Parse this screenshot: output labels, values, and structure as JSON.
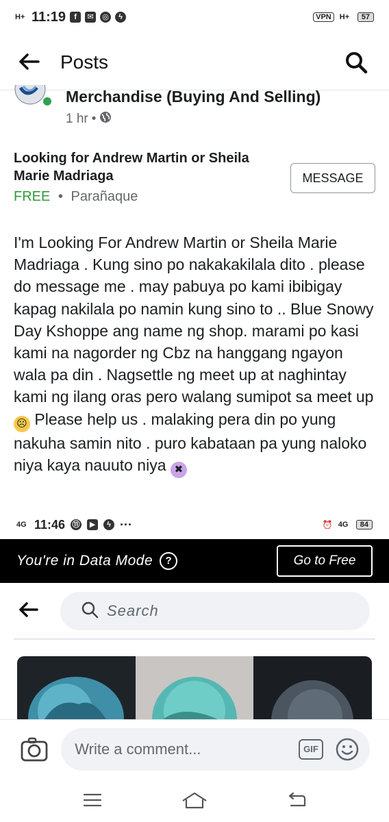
{
  "status_bar": {
    "network": "H+",
    "time": "11:19",
    "vpn": "VPN",
    "network_right": "H+",
    "battery": "57"
  },
  "header": {
    "title": "Posts"
  },
  "group": {
    "name": "Merchandise (Buying And Selling)",
    "time": "1 hr",
    "separator": "•"
  },
  "listing": {
    "title": "Looking for Andrew Martin or Sheila Marie Madriaga",
    "price": "FREE",
    "separator": "•",
    "location": "Parañaque",
    "message_button": "MESSAGE"
  },
  "post": {
    "text_part1": "I'm Looking For Andrew Martin or Sheila Marie Madriaga . Kung sino po nakakakilala dito . please do message me . may pabuya po kami ibibigay kapag nakilala po namin kung sino to .. Blue Snowy Day Kshoppe ang name ng shop. marami po kasi kami na nagorder ng Cbz na hanggang ngayon wala pa din . Nagsettle ng meet up at naghintay kami ng ilang oras pero walang sumipot sa meet up",
    "text_part2": " Please help us . malaking pera din po yung nakuha samin nito . puro kabataan pa yung naloko niya kaya nauuto niya"
  },
  "embedded_screenshot": {
    "network": "4G",
    "time": "11:46",
    "more": "···",
    "network_right": "4G",
    "battery": "84",
    "data_mode_text": "You're in Data Mode",
    "help": "?",
    "go_to_free": "Go to Free",
    "search_placeholder": "Search"
  },
  "comment_bar": {
    "placeholder": "Write a comment...",
    "gif": "GIF"
  },
  "colors": {
    "free_green": "#2e9a3b",
    "meta_gray": "#65676b",
    "input_bg": "#f0f2f5"
  },
  "icons": [
    "back-arrow-icon",
    "search-icon",
    "globe-icon",
    "camera-icon",
    "gif-icon",
    "smiley-icon",
    "menu-icon",
    "home-icon",
    "back-nav-icon"
  ]
}
